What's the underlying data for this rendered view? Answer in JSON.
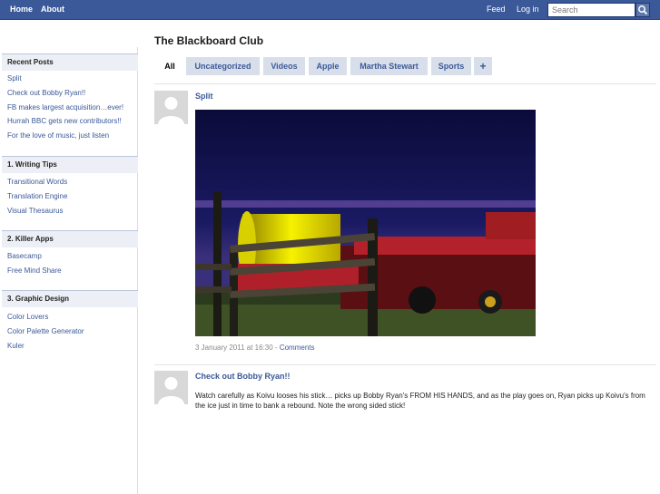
{
  "topbar": {
    "nav": [
      "Home",
      "About"
    ],
    "feed": "Feed",
    "login": "Log in",
    "search_placeholder": "Search"
  },
  "sidebar": {
    "recent_posts": {
      "heading": "Recent Posts",
      "items": [
        "Split",
        "Check out Bobby Ryan!!",
        "FB makes largest acquisition…ever!",
        "Hurrah BBC gets new contributors!!",
        "For the love of music, just listen"
      ]
    },
    "writing_tips": {
      "heading": "1. Writing Tips",
      "items": [
        "Transitional Words",
        "Translation Engine",
        "Visual Thesaurus"
      ]
    },
    "killer_apps": {
      "heading": "2. Killer Apps",
      "items": [
        "Basecamp",
        "Free Mind Share"
      ]
    },
    "graphic_design": {
      "heading": "3. Graphic Design",
      "items": [
        "Color Lovers",
        "Color Palette Generator",
        "Kuler"
      ]
    }
  },
  "main": {
    "site_title": "The Blackboard Club",
    "tabs": [
      "All",
      "Uncategorized",
      "Videos",
      "Apple",
      "Martha Stewart",
      "Sports",
      "+"
    ],
    "active_tab": "All",
    "posts": [
      {
        "title": "Split",
        "meta_date": "3 January 2011 at 16:30 - ",
        "meta_link": "Comments"
      },
      {
        "title": "Check out Bobby Ryan!!",
        "body": "Watch carefully as Koivu looses his stick… picks up Bobby Ryan's FROM HIS HANDS, and as the play goes on, Ryan picks up Koivu's from the ice just in time to bank a rebound. Note the wrong sided stick!"
      }
    ]
  },
  "colors": {
    "topbar": "#3b5998",
    "link": "#3b5998",
    "tab_bg": "#d8dfea",
    "sidebar_head_bg": "#eceff5"
  },
  "icons": {
    "search": "magnifier-icon",
    "avatar": "default-avatar-icon"
  }
}
